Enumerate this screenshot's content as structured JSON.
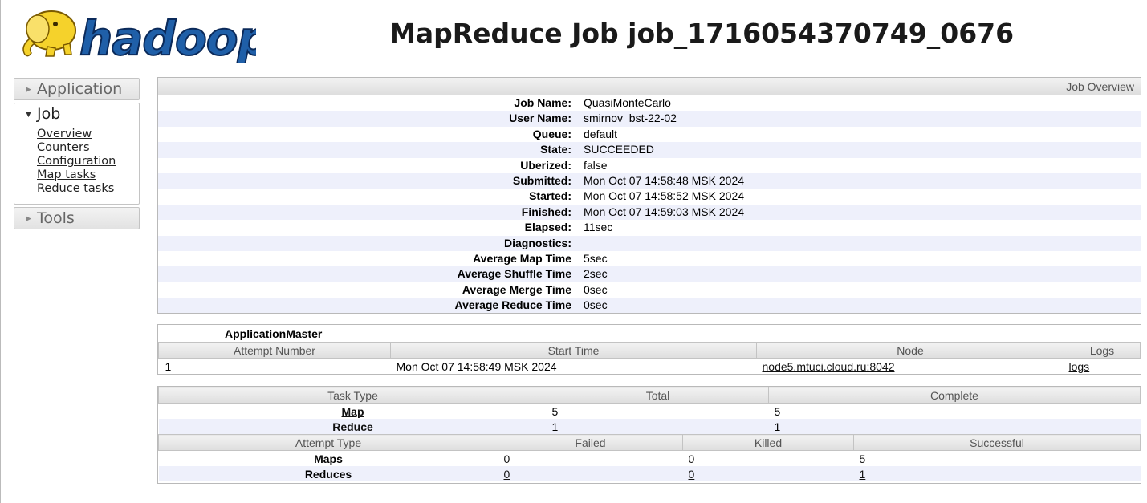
{
  "header": {
    "logo_text": "hadoop",
    "title": "MapReduce Job job_1716054370749_0676"
  },
  "sidebar": {
    "sections": [
      {
        "label": "Application",
        "state": "collapsed"
      },
      {
        "label": "Job",
        "state": "open",
        "links": [
          "Overview",
          "Counters",
          "Configuration",
          "Map tasks",
          "Reduce tasks"
        ]
      },
      {
        "label": "Tools",
        "state": "collapsed"
      }
    ]
  },
  "overview": {
    "header": "Job Overview",
    "rows": [
      {
        "label": "Job Name:",
        "value": "QuasiMonteCarlo"
      },
      {
        "label": "User Name:",
        "value": "smirnov_bst-22-02"
      },
      {
        "label": "Queue:",
        "value": "default"
      },
      {
        "label": "State:",
        "value": "SUCCEEDED"
      },
      {
        "label": "Uberized:",
        "value": "false"
      },
      {
        "label": "Submitted:",
        "value": "Mon Oct 07 14:58:48 MSK 2024"
      },
      {
        "label": "Started:",
        "value": "Mon Oct 07 14:58:52 MSK 2024"
      },
      {
        "label": "Finished:",
        "value": "Mon Oct 07 14:59:03 MSK 2024"
      },
      {
        "label": "Elapsed:",
        "value": "11sec"
      },
      {
        "label": "Diagnostics:",
        "value": ""
      },
      {
        "label": "Average Map Time",
        "value": "5sec"
      },
      {
        "label": "Average Shuffle Time",
        "value": "2sec"
      },
      {
        "label": "Average Merge Time",
        "value": "0sec"
      },
      {
        "label": "Average Reduce Time",
        "value": "0sec"
      }
    ]
  },
  "app_master": {
    "title": "ApplicationMaster",
    "columns": [
      "Attempt Number",
      "Start Time",
      "Node",
      "Logs"
    ],
    "row": {
      "attempt": "1",
      "start_time": "Mon Oct 07 14:58:49 MSK 2024",
      "node": "node5.mtuci.cloud.ru:8042",
      "logs": "logs"
    }
  },
  "tasks": {
    "task_columns": [
      "Task Type",
      "Total",
      "Complete"
    ],
    "task_rows": [
      {
        "type": "Map",
        "total": "5",
        "complete": "5"
      },
      {
        "type": "Reduce",
        "total": "1",
        "complete": "1"
      }
    ],
    "attempt_columns": [
      "Attempt Type",
      "Failed",
      "Killed",
      "Successful"
    ],
    "attempt_rows": [
      {
        "type": "Maps",
        "failed": "0",
        "killed": "0",
        "successful": "5"
      },
      {
        "type": "Reduces",
        "failed": "0",
        "killed": "0",
        "successful": "1"
      }
    ]
  },
  "colors": {
    "logo_yellow": "#f5d22b",
    "logo_blue": "#1f5fa8",
    "row_stripe": "#eef0fb"
  }
}
